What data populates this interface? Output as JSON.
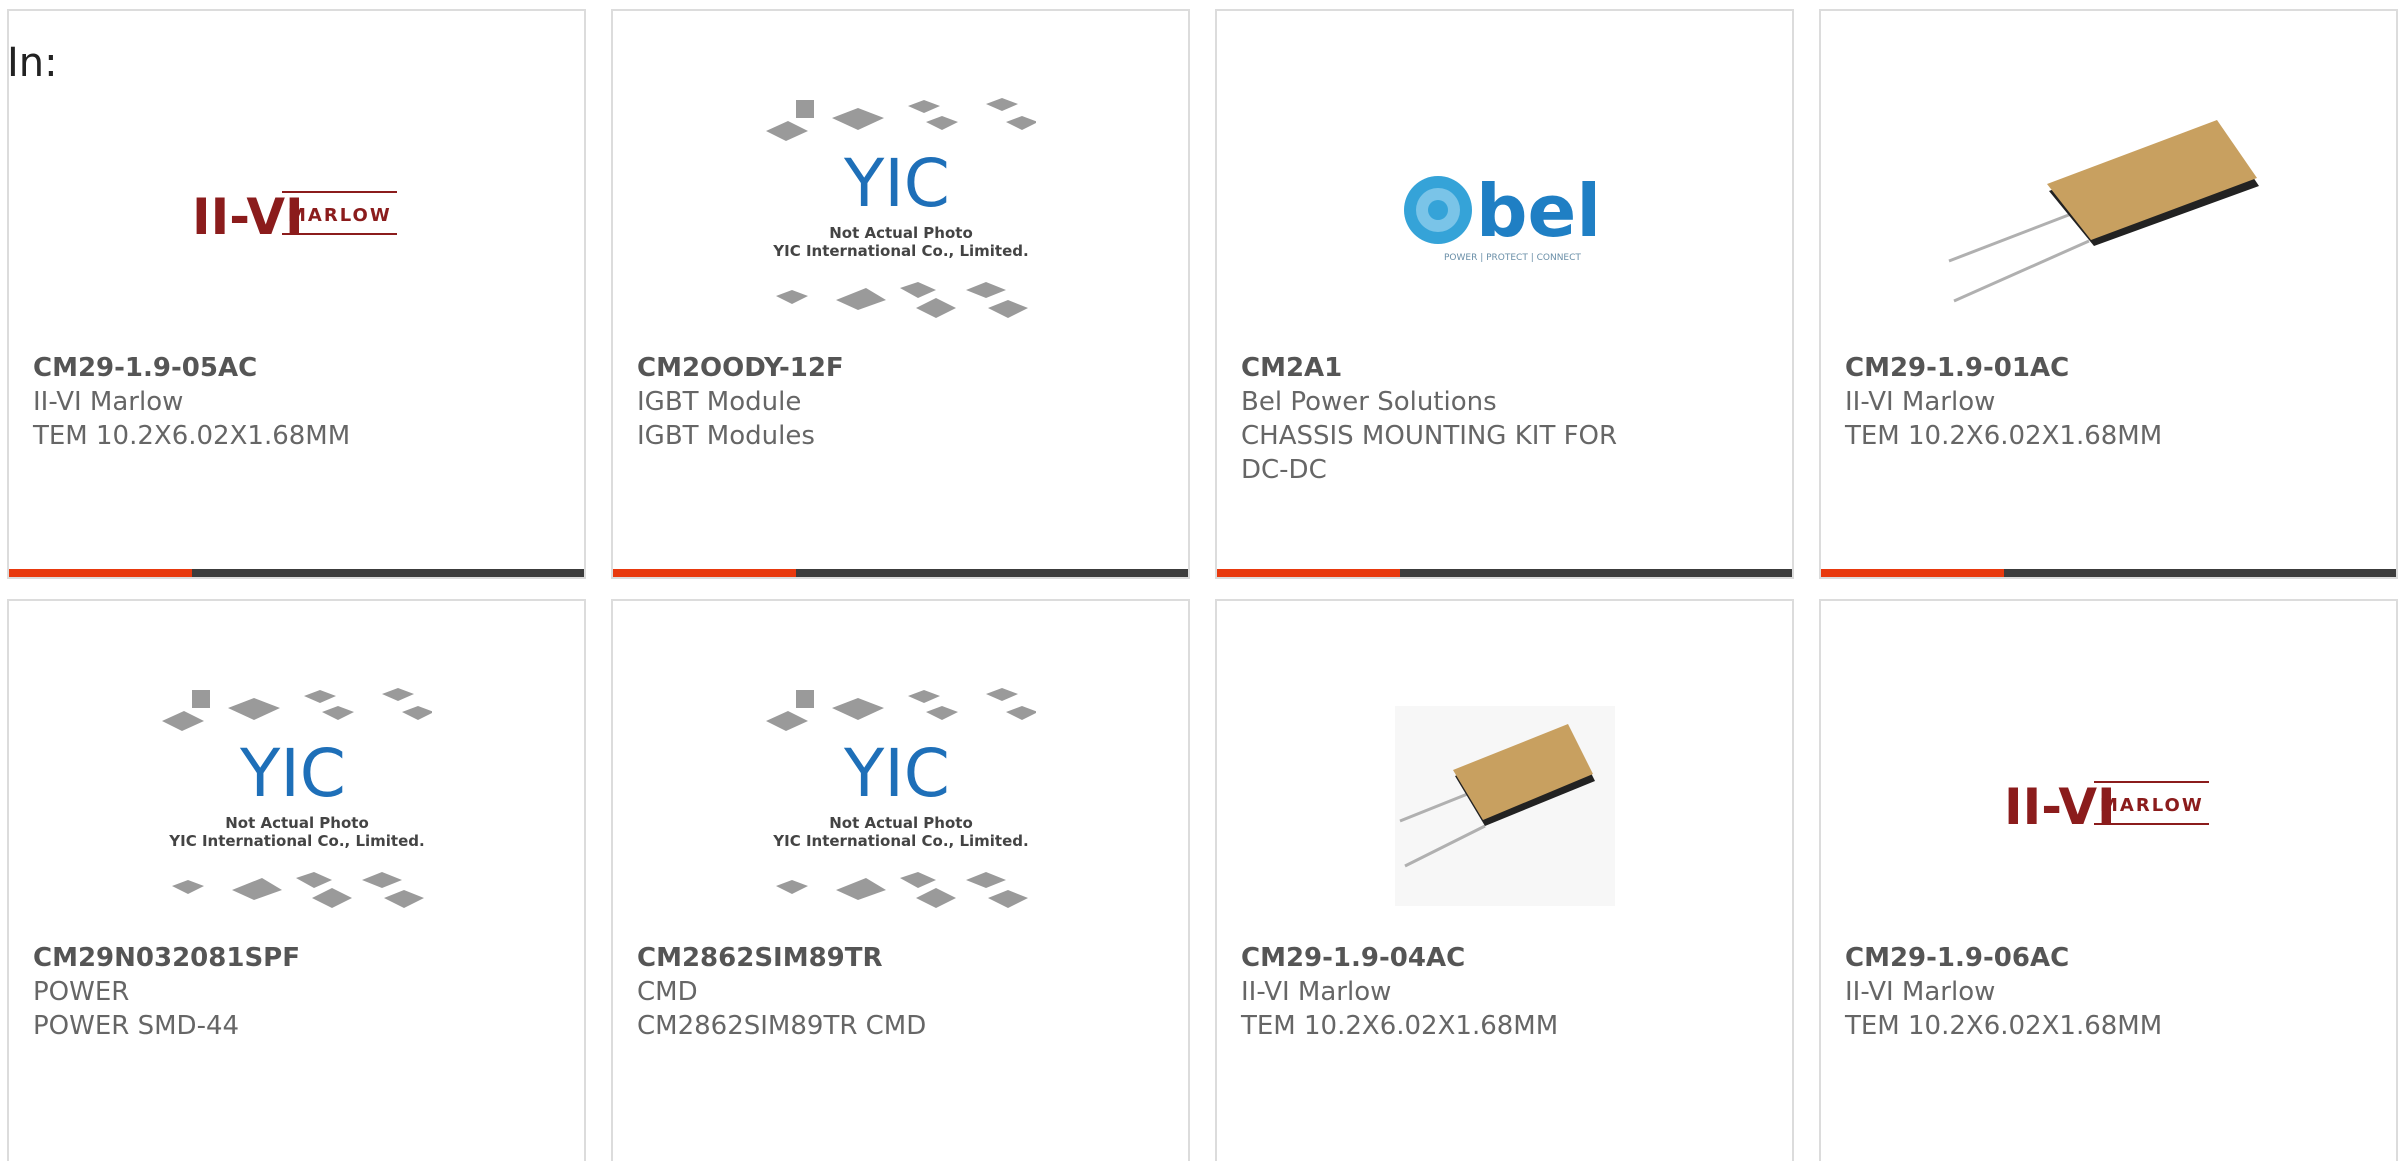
{
  "header": {
    "filter_label": "In:"
  },
  "theme": {
    "accent": "#e8390e",
    "bar": "#3c3c3c",
    "border": "#dcdcdc",
    "text": "#666666"
  },
  "logos": {
    "marlow_mark": "II-VI",
    "marlow_word": "MARLOW",
    "bel_word": "bel",
    "bel_tagline": "POWER | PROTECT | CONNECT",
    "yic_mark": "YIC",
    "yic_line1": "Not Actual Photo",
    "yic_line2": "YIC International Co., Limited."
  },
  "products": [
    {
      "part": "CM29-1.9-05AC",
      "maker": "II-VI Marlow",
      "desc": "TEM 10.2X6.02X1.68MM",
      "image": "marlow-logo"
    },
    {
      "part": "CM2OODY-12F",
      "maker": "IGBT Module",
      "desc": "IGBT Modules",
      "image": "yic-placeholder"
    },
    {
      "part": "CM2A1",
      "maker": "Bel Power Solutions",
      "desc": "CHASSIS MOUNTING KIT FOR DC-DC",
      "image": "bel-logo"
    },
    {
      "part": "CM29-1.9-01AC",
      "maker": "II-VI Marlow",
      "desc": "TEM 10.2X6.02X1.68MM",
      "image": "tem-module-photo"
    },
    {
      "part": "CM29N032081SPF",
      "maker": "POWER",
      "desc": "POWER SMD-44",
      "image": "yic-placeholder"
    },
    {
      "part": "CM2862SIM89TR",
      "maker": "CMD",
      "desc": "CM2862SIM89TR CMD",
      "image": "yic-placeholder"
    },
    {
      "part": "CM29-1.9-04AC",
      "maker": "II-VI Marlow",
      "desc": "TEM 10.2X6.02X1.68MM",
      "image": "tem-module-photo"
    },
    {
      "part": "CM29-1.9-06AC",
      "maker": "II-VI Marlow",
      "desc": "TEM 10.2X6.02X1.68MM",
      "image": "marlow-logo"
    }
  ]
}
